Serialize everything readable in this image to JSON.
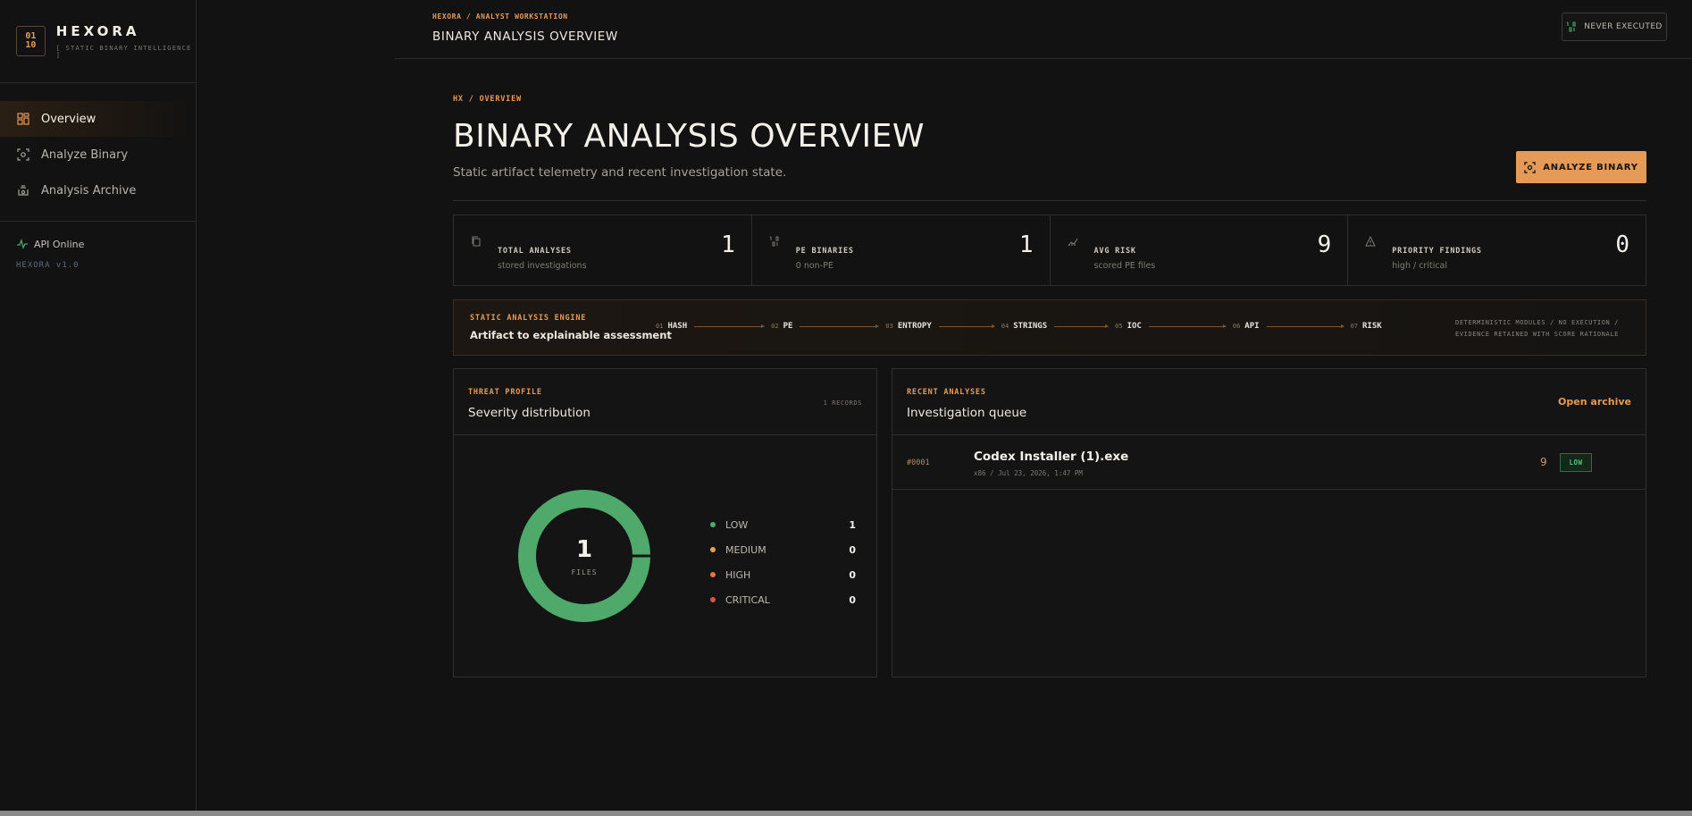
{
  "brand": {
    "logo_top": "01",
    "logo_bottom": "10",
    "name": "HEXORA",
    "tagline": "[ STATIC BINARY INTELLIGENCE ]"
  },
  "nav": {
    "items": [
      {
        "label": "Overview",
        "icon": "grid-icon",
        "active": true
      },
      {
        "label": "Analyze Binary",
        "icon": "scan-icon",
        "active": false
      },
      {
        "label": "Analysis Archive",
        "icon": "archive-icon",
        "active": false
      }
    ]
  },
  "status": {
    "api": "API Online",
    "version": "HEXORA v1.0"
  },
  "topbar": {
    "crumb": "HEXORA / ANALYST WORKSTATION",
    "title": "BINARY ANALYSIS OVERVIEW",
    "execution": "NEVER EXECUTED"
  },
  "page": {
    "crumb": "HX / OVERVIEW",
    "title": "BINARY ANALYSIS OVERVIEW",
    "subtitle": "Static artifact telemetry and recent investigation state.",
    "analyze_button": "ANALYZE BINARY"
  },
  "stats": [
    {
      "label": "TOTAL ANALYSES",
      "sub": "stored investigations",
      "value": "1"
    },
    {
      "label": "PE BINARIES",
      "sub": "0 non-PE",
      "value": "1"
    },
    {
      "label": "AVG RISK",
      "sub": "scored PE files",
      "value": "9"
    },
    {
      "label": "PRIORITY FINDINGS",
      "sub": "high / critical",
      "value": "0"
    }
  ],
  "engine": {
    "title": "STATIC ANALYSIS ENGINE",
    "subtitle": "Artifact to explainable assessment",
    "steps": [
      {
        "num": "01",
        "name": "HASH"
      },
      {
        "num": "02",
        "name": "PE"
      },
      {
        "num": "03",
        "name": "ENTROPY"
      },
      {
        "num": "04",
        "name": "STRINGS"
      },
      {
        "num": "05",
        "name": "IOC"
      },
      {
        "num": "06",
        "name": "API"
      },
      {
        "num": "07",
        "name": "RISK"
      }
    ],
    "note_line1": "DETERMINISTIC MODULES / NO EXECUTION /",
    "note_line2": "EVIDENCE RETAINED WITH SCORE RATIONALE"
  },
  "threat": {
    "kicker": "THREAT PROFILE",
    "title": "Severity distribution",
    "records": "1 RECORDS",
    "center_count": "1",
    "center_label": "FILES",
    "legend": [
      {
        "label": "LOW",
        "value": "1",
        "color": "#4fa96a"
      },
      {
        "label": "MEDIUM",
        "value": "0",
        "color": "#e6a24c"
      },
      {
        "label": "HIGH",
        "value": "0",
        "color": "#e0744a"
      },
      {
        "label": "CRITICAL",
        "value": "0",
        "color": "#d9534f"
      }
    ]
  },
  "recent": {
    "kicker": "RECENT ANALYSES",
    "title": "Investigation queue",
    "open_archive": "Open archive",
    "rows": [
      {
        "id": "#0001",
        "name": "Codex Installer (1).exe",
        "meta": "x86 / Jul 23, 2026, 1:47 PM",
        "score": "9",
        "severity": "LOW"
      }
    ]
  },
  "colors": {
    "accent": "#e59a57",
    "low": "#4fa96a",
    "bg": "#121212"
  }
}
